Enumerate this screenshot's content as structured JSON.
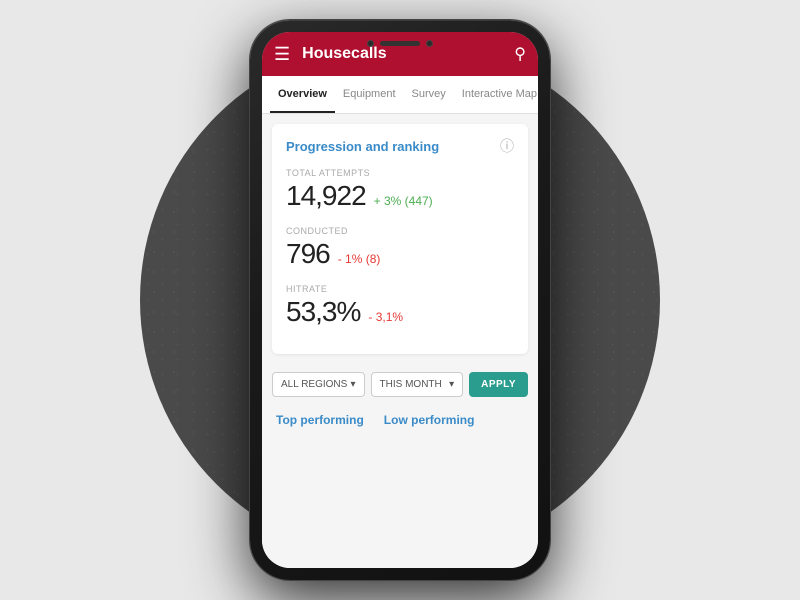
{
  "background": {
    "circle_color": "#4a4a4a"
  },
  "phone": {
    "top_bar": {
      "title": "Housecalls",
      "search_label": "search"
    },
    "tabs": [
      {
        "label": "Overview",
        "active": true
      },
      {
        "label": "Equipment",
        "active": false
      },
      {
        "label": "Survey",
        "active": false
      },
      {
        "label": "Interactive Map",
        "active": false
      }
    ],
    "card": {
      "title": "Progression and ranking",
      "stats": [
        {
          "label": "TOTAL ATTEMPTS",
          "number": "14,922",
          "change": "+ 3% (447)",
          "direction": "positive"
        },
        {
          "label": "CONDUCTED",
          "number": "796",
          "change": "- 1% (8)",
          "direction": "negative"
        },
        {
          "label": "HITRATE",
          "number": "53,3%",
          "change": "- 3,1%",
          "direction": "negative"
        }
      ]
    },
    "filters": {
      "region_label": "ALL REGIONS",
      "month_label": "THIS MONTH",
      "apply_label": "APPLY"
    },
    "bottom": {
      "top_performing": "Top performing",
      "low_performing": "Low performing"
    }
  }
}
